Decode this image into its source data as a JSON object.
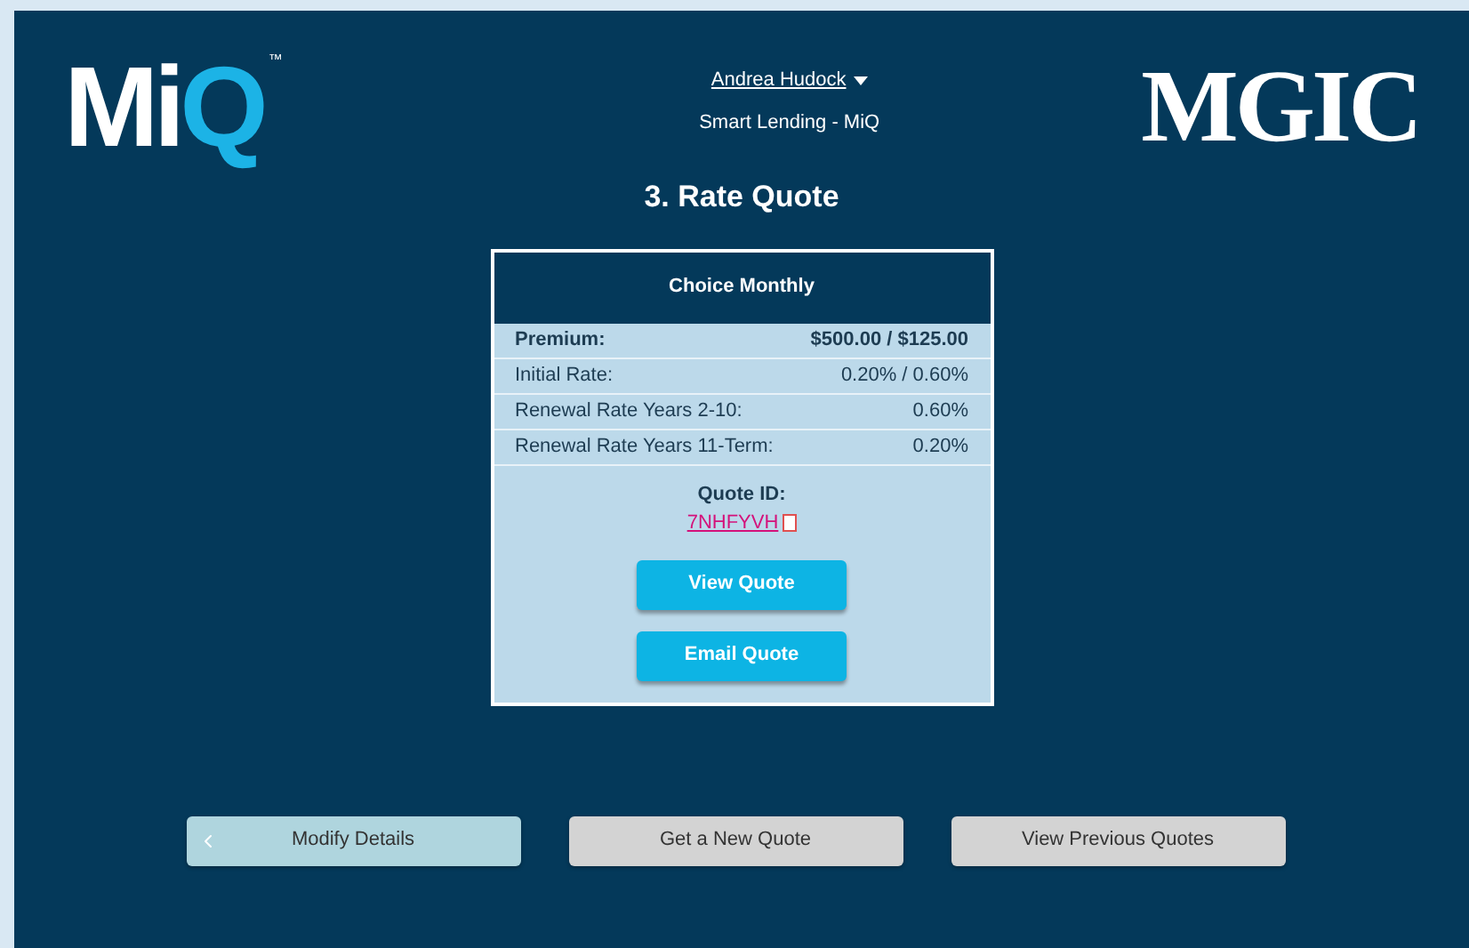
{
  "header": {
    "logo_left": {
      "text": "MiQ",
      "mark": "™"
    },
    "user_menu": "Andrea Hudock",
    "subtitle": "Smart Lending - MiQ",
    "logo_right": "MGIC"
  },
  "page_title": "3. Rate Quote",
  "quote_card": {
    "title": "Choice Monthly",
    "rows": [
      {
        "label": "Premium:",
        "value": "$500.00 / $125.00",
        "emphasis": true
      },
      {
        "label": "Initial Rate:",
        "value": "0.20% / 0.60%",
        "emphasis": false
      },
      {
        "label": "Renewal Rate Years 2-10:",
        "value": "0.60%",
        "emphasis": false
      },
      {
        "label": "Renewal Rate Years 11-Term:",
        "value": "0.20%",
        "emphasis": false
      }
    ],
    "quote_id_label": "Quote ID:",
    "quote_id": "7NHFYVH",
    "buttons": [
      "View Quote",
      "Email Quote"
    ]
  },
  "footer_buttons": [
    {
      "label": "Modify Details",
      "kind": "back"
    },
    {
      "label": "Get a New Quote",
      "kind": "plain"
    },
    {
      "label": "View Previous Quotes",
      "kind": "plain"
    }
  ]
}
